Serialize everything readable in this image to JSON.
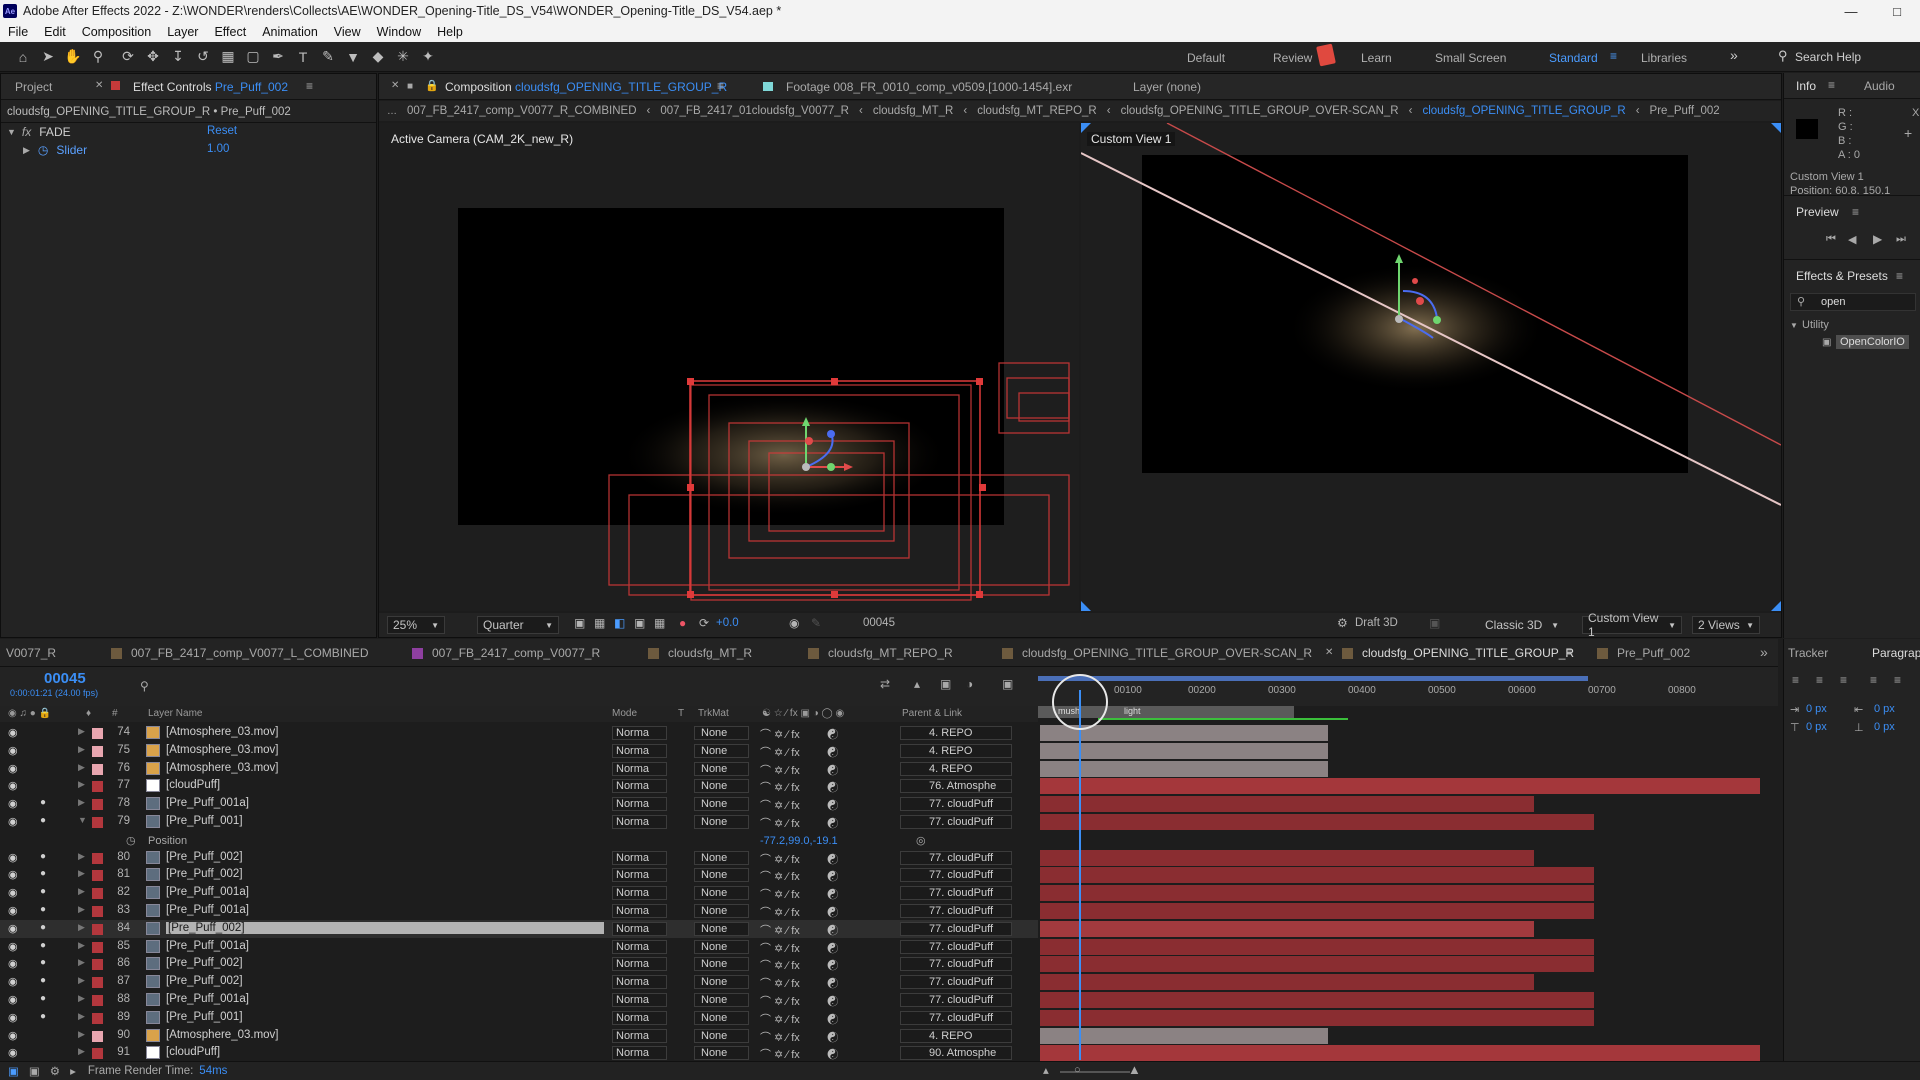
{
  "app": {
    "title": "Adobe After Effects 2022 - Z:\\WONDER\\renders\\Collects\\AE\\WONDER_Opening-Title_DS_V54\\WONDER_Opening-Title_DS_V54.aep *",
    "logo": "Ae"
  },
  "menu": [
    "File",
    "Edit",
    "Composition",
    "Layer",
    "Effect",
    "Animation",
    "View",
    "Window",
    "Help"
  ],
  "workspaces": [
    "Default",
    "Review",
    "Learn",
    "Small Screen",
    "Standard",
    "Libraries"
  ],
  "search_help": "Search Help",
  "project_panel": {
    "tab_project": "Project",
    "tab_effect_controls": "Effect Controls",
    "effect_layer": "Pre_Puff_002",
    "path": "cloudsfg_OPENING_TITLE_GROUP_R • Pre_Puff_002",
    "fx_name": "FADE",
    "fx_reset": "Reset",
    "slider_label": "Slider",
    "slider_value": "1.00"
  },
  "comp_panel": {
    "tab_label": "Composition",
    "comp_name": "cloudsfg_OPENING_TITLE_GROUP_R",
    "footage_label": "Footage 008_FR_0010_comp_v0509.[1000-1454].exr",
    "layer_label": "Layer (none)",
    "breadcrumbs": [
      "007_FB_2417_comp_V0077_R_COMBINED",
      "007_FB_2417_01cloudsfg_V0077_R",
      "cloudsfg_MT_R",
      "cloudsfg_MT_REPO_R",
      "cloudsfg_OPENING_TITLE_GROUP_OVER-SCAN_R",
      "cloudsfg_OPENING_TITLE_GROUP_R",
      "Pre_Puff_002"
    ],
    "left_view_label": "Active Camera (CAM_2K_new_R)",
    "right_view_label": "Custom View 1",
    "zoom": "25%",
    "resolution": "Quarter",
    "exposure": "+0.0",
    "frame": "00045",
    "draft3d": "Draft 3D",
    "renderer": "Classic 3D",
    "view": "Custom View 1",
    "views": "2 Views"
  },
  "right_panels": {
    "info_tab": "Info",
    "audio_tab": "Audio",
    "info_r": "R :",
    "info_g": "G :",
    "info_b": "B :",
    "info_a": "A : 0",
    "info_x": "X",
    "info_view": "Custom View 1",
    "info_pos": "Position: 60.8, 150.1",
    "preview_tab": "Preview",
    "effects_tab": "Effects & Presets",
    "effects_search": "open",
    "utility_label": "Utility",
    "opencolorio": "OpenColorIO",
    "tracker_tab": "Tracker",
    "paragraph_tab": "Paragraph",
    "px1": "0 px",
    "px2": "0 px",
    "px3": "0 px",
    "px4": "0 px"
  },
  "timeline": {
    "tabs": [
      {
        "label": "V0077_R",
        "color": ""
      },
      {
        "label": "007_FB_2417_comp_V0077_L_COMBINED",
        "color": "#6d5a3e"
      },
      {
        "label": "007_FB_2417_comp_V0077_R",
        "color": "#8e3fa0"
      },
      {
        "label": "cloudsfg_MT_R",
        "color": "#6d5a3e"
      },
      {
        "label": "cloudsfg_MT_REPO_R",
        "color": "#6d5a3e"
      },
      {
        "label": "cloudsfg_OPENING_TITLE_GROUP_OVER-SCAN_R",
        "color": "#6d5a3e"
      },
      {
        "label": "cloudsfg_OPENING_TITLE_GROUP_R",
        "color": "#6d5a3e"
      },
      {
        "label": "Pre_Puff_002",
        "color": "#6d5a3e"
      }
    ],
    "timecode": "00045",
    "timecode_sub": "0:00:01:21 (24.00 fps)",
    "col_layer_name": "Layer Name",
    "col_mode": "Mode",
    "col_t": "T",
    "col_trkmat": "TrkMat",
    "col_parent": "Parent & Link",
    "ruler": [
      "00100",
      "00200",
      "00300",
      "00400",
      "00500",
      "00600",
      "00700",
      "00800"
    ],
    "marker_labels": [
      "mush",
      "light"
    ],
    "position_label": "Position",
    "position_value": "-77.2,99.0,-19.1",
    "layers": [
      {
        "num": "74",
        "name": "[Atmosphere_03.mov]",
        "mode": "Norma",
        "trk": "None",
        "parent": "4. REPO",
        "label": "#e8a6b0",
        "type": "seq",
        "bar": "grey"
      },
      {
        "num": "75",
        "name": "[Atmosphere_03.mov]",
        "mode": "Norma",
        "trk": "None",
        "parent": "4. REPO",
        "label": "#e8a6b0",
        "type": "seq",
        "bar": "grey"
      },
      {
        "num": "76",
        "name": "[Atmosphere_03.mov]",
        "mode": "Norma",
        "trk": "None",
        "parent": "4. REPO",
        "label": "#e8a6b0",
        "type": "seq",
        "bar": "grey"
      },
      {
        "num": "77",
        "name": "[cloudPuff]",
        "mode": "Norma",
        "trk": "None",
        "parent": "76. Atmosphe",
        "label": "#b3373d",
        "type": "null",
        "bar": "long"
      },
      {
        "num": "78",
        "name": "[Pre_Puff_001a]",
        "mode": "Norma",
        "trk": "None",
        "parent": "77. cloudPuff",
        "label": "#b3373d",
        "type": "comp",
        "bar": "mid"
      },
      {
        "num": "79",
        "name": "[Pre_Puff_001]",
        "mode": "Norma",
        "trk": "None",
        "parent": "77. cloudPuff",
        "label": "#b3373d",
        "type": "comp",
        "bar": "mid2"
      },
      {
        "num": "80",
        "name": "[Pre_Puff_002]",
        "mode": "Norma",
        "trk": "None",
        "parent": "77. cloudPuff",
        "label": "#b3373d",
        "type": "comp",
        "bar": "mid"
      },
      {
        "num": "81",
        "name": "[Pre_Puff_002]",
        "mode": "Norma",
        "trk": "None",
        "parent": "77. cloudPuff",
        "label": "#b3373d",
        "type": "comp",
        "bar": "mid2"
      },
      {
        "num": "82",
        "name": "[Pre_Puff_001a]",
        "mode": "Norma",
        "trk": "None",
        "parent": "77. cloudPuff",
        "label": "#b3373d",
        "type": "comp",
        "bar": "mid2"
      },
      {
        "num": "83",
        "name": "[Pre_Puff_001a]",
        "mode": "Norma",
        "trk": "None",
        "parent": "77. cloudPuff",
        "label": "#b3373d",
        "type": "comp",
        "bar": "mid2"
      },
      {
        "num": "84",
        "name": "[Pre_Puff_002]",
        "mode": "Norma",
        "trk": "None",
        "parent": "77. cloudPuff",
        "label": "#b3373d",
        "type": "comp",
        "bar": "mid"
      },
      {
        "num": "85",
        "name": "[Pre_Puff_001a]",
        "mode": "Norma",
        "trk": "None",
        "parent": "77. cloudPuff",
        "label": "#b3373d",
        "type": "comp",
        "bar": "mid2"
      },
      {
        "num": "86",
        "name": "[Pre_Puff_002]",
        "mode": "Norma",
        "trk": "None",
        "parent": "77. cloudPuff",
        "label": "#b3373d",
        "type": "comp",
        "bar": "mid2"
      },
      {
        "num": "87",
        "name": "[Pre_Puff_002]",
        "mode": "Norma",
        "trk": "None",
        "parent": "77. cloudPuff",
        "label": "#b3373d",
        "type": "comp",
        "bar": "mid"
      },
      {
        "num": "88",
        "name": "[Pre_Puff_001a]",
        "mode": "Norma",
        "trk": "None",
        "parent": "77. cloudPuff",
        "label": "#b3373d",
        "type": "comp",
        "bar": "mid2"
      },
      {
        "num": "89",
        "name": "[Pre_Puff_001]",
        "mode": "Norma",
        "trk": "None",
        "parent": "77. cloudPuff",
        "label": "#b3373d",
        "type": "comp",
        "bar": "mid2"
      },
      {
        "num": "90",
        "name": "[Atmosphere_03.mov]",
        "mode": "Norma",
        "trk": "None",
        "parent": "4. REPO",
        "label": "#e8a6b0",
        "type": "seq",
        "bar": "grey"
      },
      {
        "num": "91",
        "name": "[cloudPuff]",
        "mode": "Norma",
        "trk": "None",
        "parent": "90. Atmosphe",
        "label": "#b3373d",
        "type": "null",
        "bar": "long"
      }
    ],
    "status_label": "Frame Render Time:",
    "status_value": "54ms"
  }
}
